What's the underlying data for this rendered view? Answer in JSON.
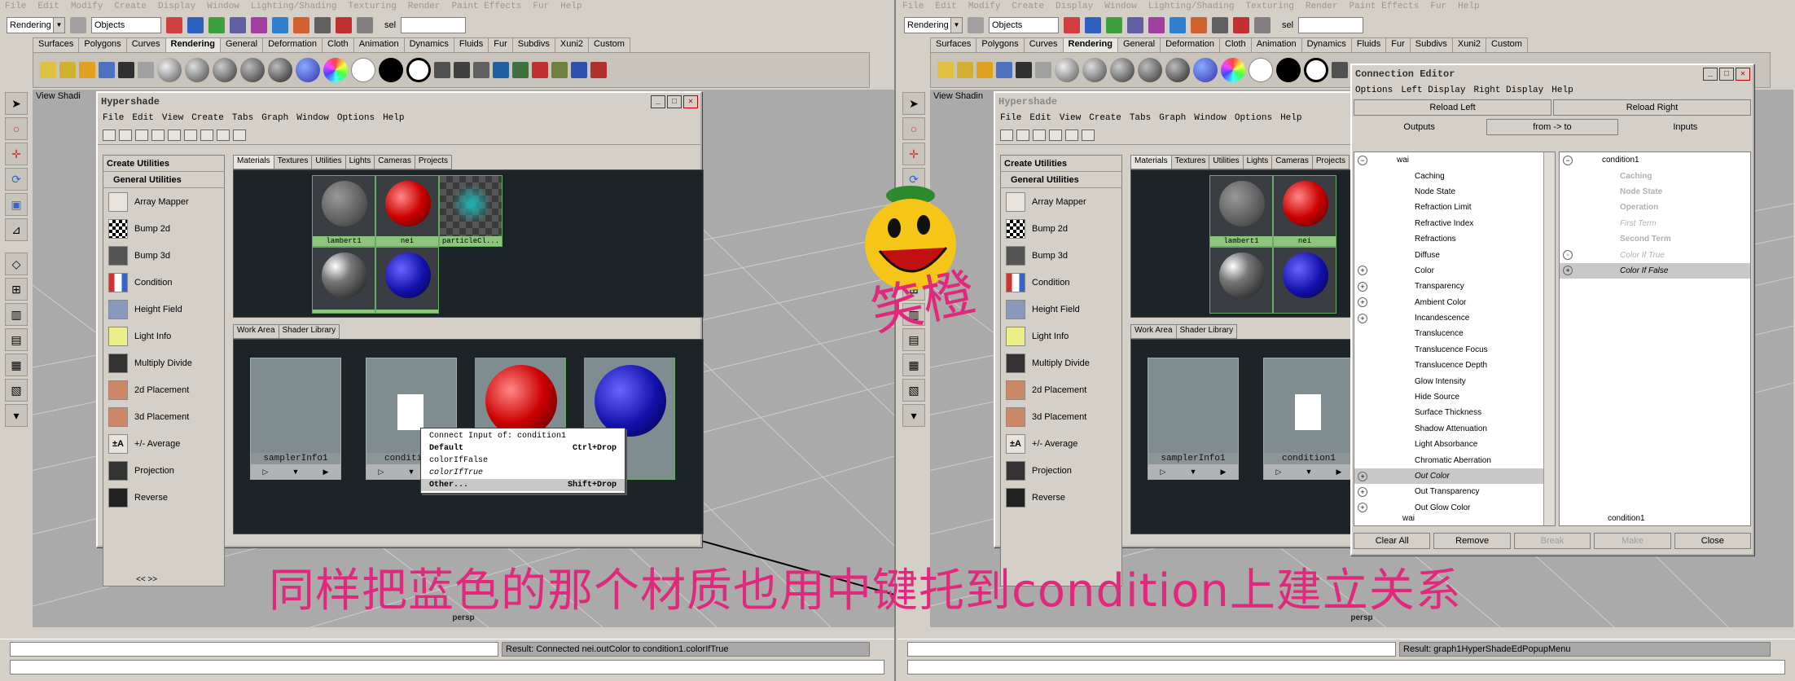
{
  "main_menu": [
    "File",
    "Edit",
    "Modify",
    "Create",
    "Display",
    "Window",
    "Lighting/Shading",
    "Texturing",
    "Render",
    "Paint Effects",
    "Fur",
    "Help"
  ],
  "toolbar": {
    "mode_combo": "Rendering",
    "objects_combo": "Objects",
    "sel_label": "sel"
  },
  "shelf_tabs": [
    "Surfaces",
    "Polygons",
    "Curves",
    "Rendering",
    "General",
    "Deformation",
    "Cloth",
    "Animation",
    "Dynamics",
    "Fluids",
    "Fur",
    "Subdivs",
    "Xuni2",
    "Custom"
  ],
  "shelf_active": "Rendering",
  "viewport": {
    "menu_left": "View Shadi",
    "menu_right": "View Shadin",
    "camera": "persp"
  },
  "hypershade": {
    "title": "Hypershade",
    "menu": [
      "File",
      "Edit",
      "View",
      "Create",
      "Tabs",
      "Graph",
      "Window",
      "Options",
      "Help"
    ],
    "create_panel_title": "Create Utilities",
    "section_title": "General Utilities",
    "utilities": [
      "Array Mapper",
      "Bump 2d",
      "Bump 3d",
      "Condition",
      "Height Field",
      "Light Info",
      "Multiply Divide",
      "2d Placement",
      "3d Placement",
      "+/- Average",
      "Projection",
      "Reverse"
    ],
    "panel_scroll": "<<    >>",
    "top_tabs": [
      "Materials",
      "Textures",
      "Utilities",
      "Lights",
      "Cameras",
      "Projects"
    ],
    "materials": [
      "lambert1",
      "nei",
      "particleCl...",
      "",
      ""
    ],
    "work_tabs": [
      "Work Area",
      "Shader Library"
    ],
    "nodes": [
      "samplerInfo1",
      "condition1"
    ]
  },
  "context_menu": {
    "header": "Connect Input of: condition1",
    "items": [
      {
        "label": "Default",
        "key": "Ctrl+Drop"
      },
      {
        "label": "colorIfFalse",
        "key": ""
      },
      {
        "label": "colorIfTrue",
        "key": ""
      },
      {
        "label": "Other...",
        "key": "Shift+Drop"
      }
    ]
  },
  "connection_editor": {
    "title": "Connection Editor",
    "menu": [
      "Options",
      "Left Display",
      "Right Display",
      "Help"
    ],
    "reload_left": "Reload Left",
    "reload_right": "Reload Right",
    "outputs": "Outputs",
    "direction": "from -> to",
    "inputs": "Inputs",
    "left_list": {
      "root": "wai",
      "items": [
        "Caching",
        "Node State",
        "Refraction Limit",
        "Refractive Index",
        "Refractions",
        "Diffuse",
        "Color",
        "Transparency",
        "Ambient Color",
        "Incandescence",
        "Translucence",
        "Translucence Focus",
        "Translucence Depth",
        "Glow Intensity",
        "Hide Source",
        "Surface Thickness",
        "Shadow Attenuation",
        "Light Absorbance",
        "Chromatic Aberration",
        "Out Color",
        "Out Transparency",
        "Out Glow Color"
      ]
    },
    "right_list": {
      "root": "condition1",
      "items": [
        "Caching",
        "Node State",
        "Operation",
        "First Term",
        "Second Term",
        "Color If True",
        "Color If False"
      ]
    },
    "left_node": "wai",
    "right_node": "condition1",
    "buttons": [
      "Clear All",
      "Remove",
      "Break",
      "Make",
      "Close"
    ]
  },
  "status": {
    "result_left": "Result: Connected nei.outColor to condition1.colorIfTrue",
    "result_right": "Result: graph1HyperShadeEdPopupMenu"
  },
  "caption": "同样把蓝色的那个材质也用中键托到condition上建立关系",
  "logo_text": "笑橙",
  "colors": {
    "accent": "#e0287c",
    "work_bg": "#1c2428",
    "swatch_label": "#8ec57d"
  }
}
